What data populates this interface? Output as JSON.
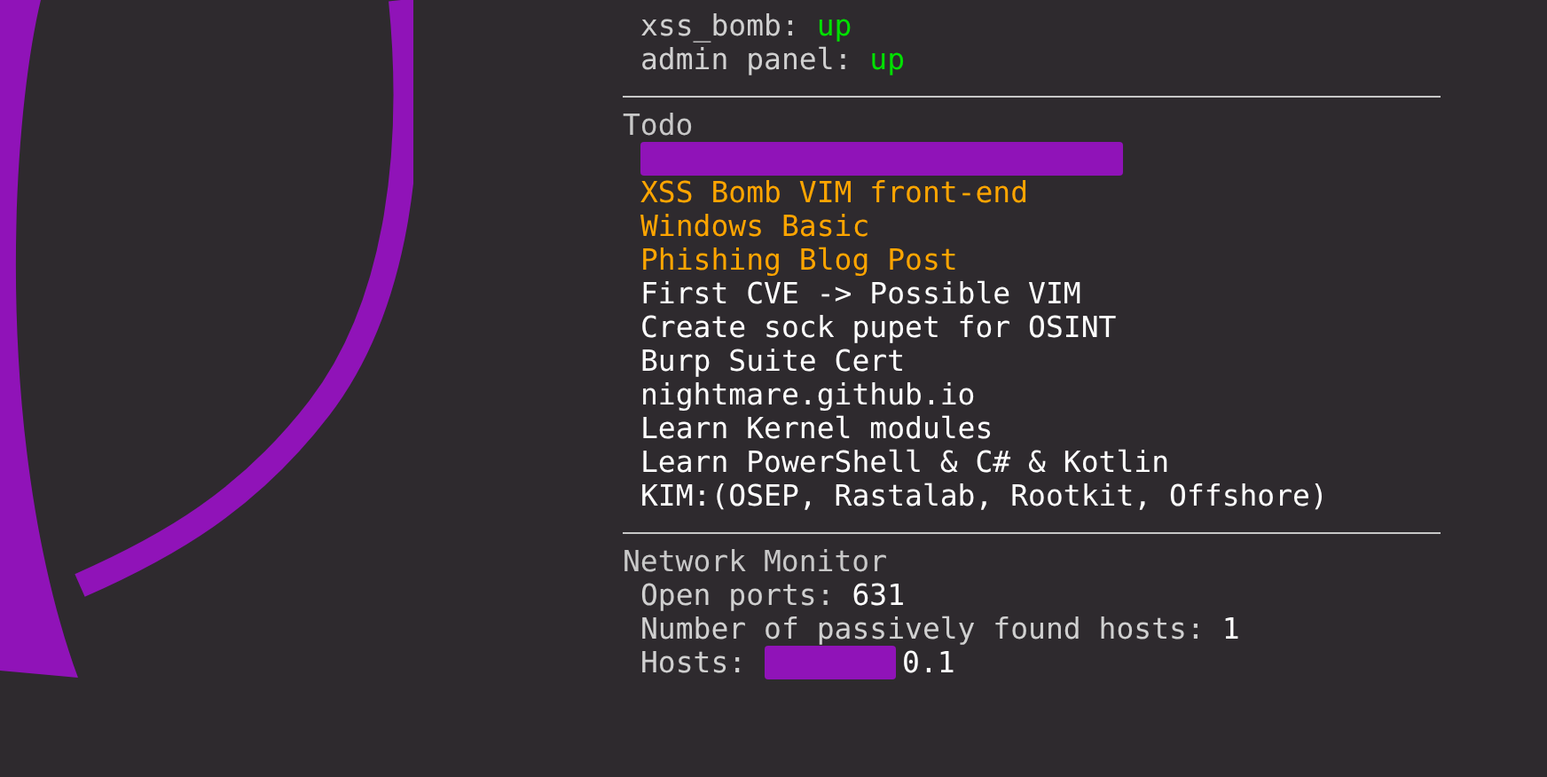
{
  "services": [
    {
      "label": "xss_bomb:",
      "value": "up",
      "up": true
    },
    {
      "label": "admin panel:",
      "value": "up",
      "up": true
    }
  ],
  "todo": {
    "title": "Todo",
    "items": [
      {
        "kind": "redacted"
      },
      {
        "kind": "text",
        "text": "XSS Bomb VIM front-end",
        "color": "#ffa500"
      },
      {
        "kind": "text",
        "text": "Windows Basic",
        "color": "#ffa500"
      },
      {
        "kind": "text",
        "text": "Phishing Blog Post",
        "color": "#ffa500"
      },
      {
        "kind": "text",
        "text": "First CVE -> Possible VIM",
        "color": "#ffffff"
      },
      {
        "kind": "text",
        "text": "Create sock pupet for OSINT",
        "color": "#ffffff"
      },
      {
        "kind": "text",
        "text": "Burp Suite Cert",
        "color": "#ffffff"
      },
      {
        "kind": "text",
        "text": "nightmare.github.io",
        "color": "#ffffff"
      },
      {
        "kind": "text",
        "text": "Learn Kernel modules",
        "color": "#ffffff"
      },
      {
        "kind": "text",
        "text": "Learn PowerShell & C# & Kotlin",
        "color": "#ffffff"
      },
      {
        "kind": "text",
        "text": "KIM:(OSEP, Rastalab, Rootkit, Offshore)",
        "color": "#ffffff"
      }
    ]
  },
  "network_monitor": {
    "title": "Network Monitor",
    "rows": [
      {
        "label": "Open ports:",
        "value": "631"
      },
      {
        "label": "Number of passively found hosts:",
        "value": "1"
      },
      {
        "label": "Hosts:",
        "redacted": true,
        "value": "0.1"
      }
    ]
  }
}
